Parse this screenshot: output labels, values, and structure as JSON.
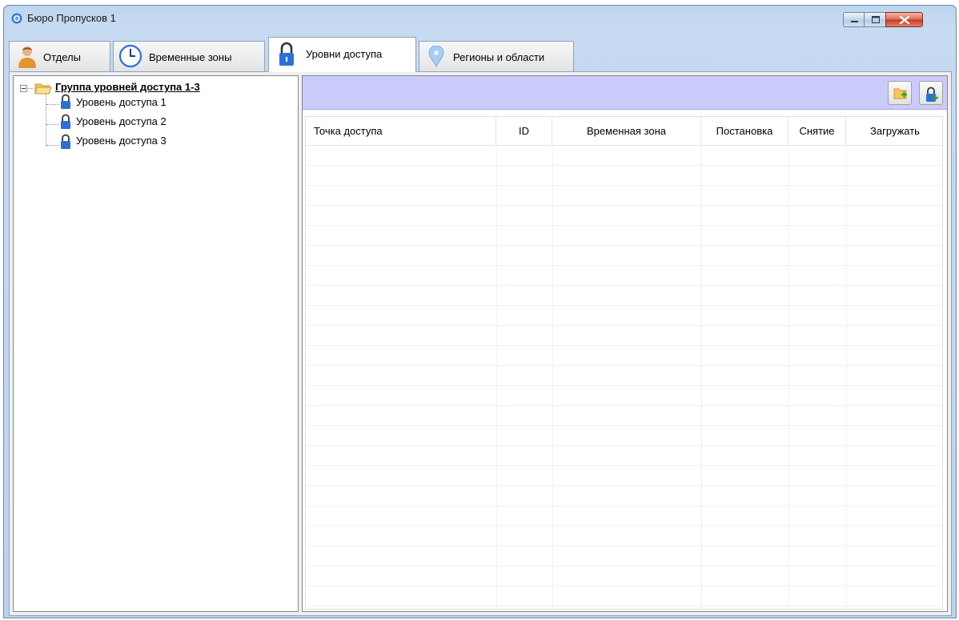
{
  "window": {
    "title": "Бюро Пропусков 1"
  },
  "tabs": [
    {
      "label": "Отделы",
      "icon": "person-icon",
      "active": false
    },
    {
      "label": "Временные зоны",
      "icon": "clock-icon",
      "active": false
    },
    {
      "label": "Уровни доступа",
      "icon": "padlock-icon",
      "active": true
    },
    {
      "label": "Регионы и области",
      "icon": "map-pin-icon",
      "active": false
    }
  ],
  "tree": {
    "group": {
      "label": "Группа уровней доступа 1-3",
      "expanded": true
    },
    "items": [
      {
        "label": "Уровень доступа 1"
      },
      {
        "label": "Уровень доступа 2"
      },
      {
        "label": "Уровень доступа 3"
      }
    ]
  },
  "toolbar": {
    "add_group_icon": "add-folder-icon",
    "add_level_icon": "add-padlock-icon",
    "background": "#cbcbfb"
  },
  "grid": {
    "columns": [
      "Точка доступа",
      "ID",
      "Временная зона",
      "Постановка",
      "Снятие",
      "Загружать"
    ],
    "rows": []
  },
  "colors": {
    "window_frame": "#bcd5ef",
    "close_button": "#c43a1f",
    "padlock": "#2d6fd6"
  }
}
